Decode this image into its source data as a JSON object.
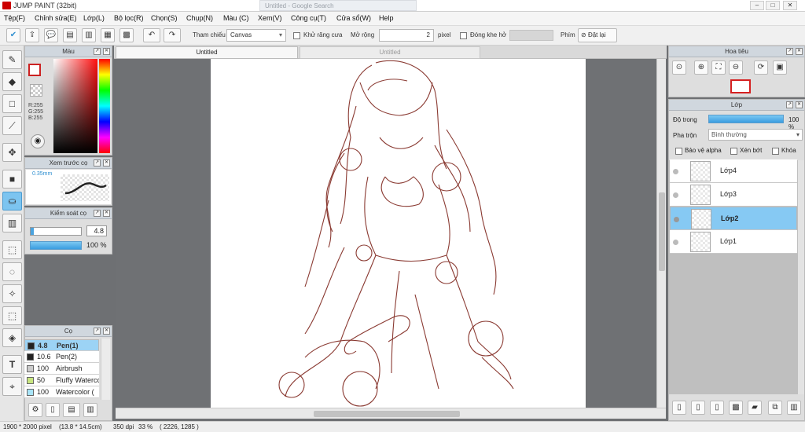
{
  "window": {
    "title": "JUMP PAINT (32bit)",
    "ghost_tab": "Untitled - Google Search"
  },
  "menu": [
    "Tệp(F)",
    "Chỉnh sửa(E)",
    "Lớp(L)",
    "Bộ lọc(R)",
    "Chọn(S)",
    "Chụp(N)",
    "Màu (C)",
    "Xem(V)",
    "Công cụ(T)",
    "Cửa sổ(W)",
    "Help"
  ],
  "toolbar": {
    "reference_label": "Tham chiếu",
    "reference_value": "Canvas",
    "antialias_label": "Khử răng cưa",
    "expand_label": "Mở rộng",
    "expand_value": "2",
    "expand_unit": "pixel",
    "close_gap_label": "Đóng khe hở",
    "key_label": "Phím",
    "reset_label": "Đặt lại"
  },
  "tabs": [
    "Untitled",
    "Untitled"
  ],
  "color_panel": {
    "title": "Màu",
    "r": "R:255",
    "g": "G:255",
    "b": "B:255",
    "accent_color": "#cc2222"
  },
  "brush_preview": {
    "title": "Xem trước cọ",
    "size": "0.35mm"
  },
  "brush_control": {
    "title": "Kiểm soát cọ",
    "size": "4.8",
    "opacity": "100 %"
  },
  "brush_list": {
    "title": "Cọ",
    "items": [
      {
        "size": "4.8",
        "name": "Pen(1)",
        "color": "#222222",
        "selected": true
      },
      {
        "size": "10.6",
        "name": "Pen(2)",
        "color": "#222222",
        "selected": false
      },
      {
        "size": "100",
        "name": "Airbrush",
        "color": "#cccccc",
        "selected": false
      },
      {
        "size": "50",
        "name": "Fluffy Watercolor",
        "color": "#c8e680",
        "selected": false
      },
      {
        "size": "100",
        "name": "Watercolor (",
        "color": "#a8e4f8",
        "selected": false
      }
    ]
  },
  "navigator": {
    "title": "Hoa tiêu"
  },
  "layer_panel": {
    "title": "Lớp",
    "opacity_label": "Độ trong",
    "opacity_value": "100 %",
    "opacity_level": 1.0,
    "blend_label": "Pha trộn",
    "blend_value": "Bình thường",
    "protect_alpha": "Bảo vệ alpha",
    "clipping": "Xén bớt",
    "lock": "Khóa",
    "layers": [
      {
        "name": "Lớp4",
        "selected": false
      },
      {
        "name": "Lớp3",
        "selected": false
      },
      {
        "name": "Lớp2",
        "selected": true
      },
      {
        "name": "Lớp1",
        "selected": false
      }
    ]
  },
  "status": {
    "dimensions": "1900 * 2000 pixel",
    "physical": "(13.8 * 14.5cm)",
    "dpi": "350 dpi",
    "zoom": "33 %",
    "coords": "( 2226, 1285 )"
  },
  "colors": {
    "accent": "#2f8fd0",
    "selected_layer": "#86c9f3",
    "sketch": "#8a3a32"
  }
}
